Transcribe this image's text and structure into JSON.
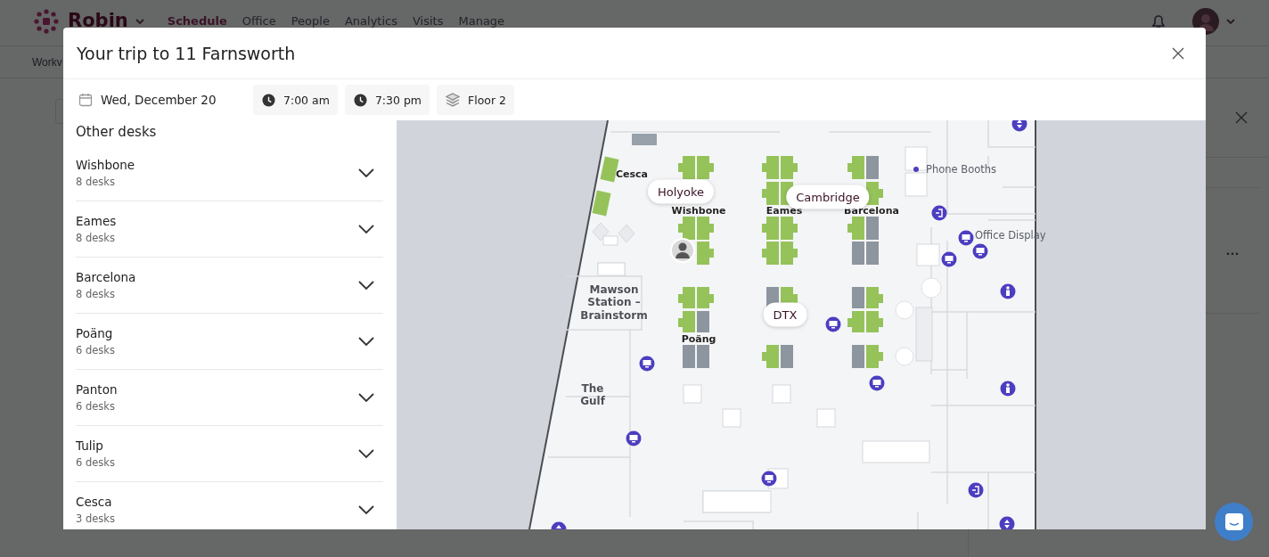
{
  "app_bar": {
    "logo": "Robin",
    "nav": [
      {
        "label": "Schedule",
        "selected": true
      },
      {
        "label": "Office",
        "selected": false
      },
      {
        "label": "People",
        "selected": false
      },
      {
        "label": "Analytics",
        "selected": false
      },
      {
        "label": "Visits",
        "selected": false
      },
      {
        "label": "Manage",
        "selected": false
      }
    ]
  },
  "sub_bar": {
    "label": "Workv"
  },
  "side_panel": {
    "more": "..."
  },
  "modal": {
    "title": "Your trip to 11 Farnsworth",
    "date": "Wed, December 20",
    "start_time": "7:00 am",
    "end_time": "7:30 pm",
    "floor": "Floor 2",
    "sidebar": {
      "heading": "Other desks",
      "items": [
        {
          "name": "Wishbone",
          "count": "8 desks",
          "expanded": false
        },
        {
          "name": "Eames",
          "count": "8 desks",
          "expanded": false
        },
        {
          "name": "Barcelona",
          "count": "8 desks",
          "expanded": false
        },
        {
          "name": "Poäng",
          "count": "6 desks",
          "expanded": false
        },
        {
          "name": "Panton",
          "count": "6 desks",
          "expanded": false
        },
        {
          "name": "Tulip",
          "count": "6 desks",
          "expanded": false
        },
        {
          "name": "Cesca",
          "count": "3 desks",
          "expanded": false
        }
      ]
    },
    "map": {
      "area_labels": [
        {
          "text": "Cesca"
        },
        {
          "text": "Wishbone"
        },
        {
          "text": "Eames"
        },
        {
          "text": "Barcelona"
        },
        {
          "text": "Poäng"
        }
      ],
      "room_labels": [
        {
          "text": "Mawson Station – Brainstorm"
        },
        {
          "text": "The Gulf"
        }
      ],
      "poi_labels": [
        {
          "text": "Phone Booths"
        },
        {
          "text": "Office Display"
        }
      ],
      "bubbles": [
        {
          "text": "Holyoke"
        },
        {
          "text": "Cambridge"
        },
        {
          "text": "DTX"
        }
      ]
    }
  }
}
